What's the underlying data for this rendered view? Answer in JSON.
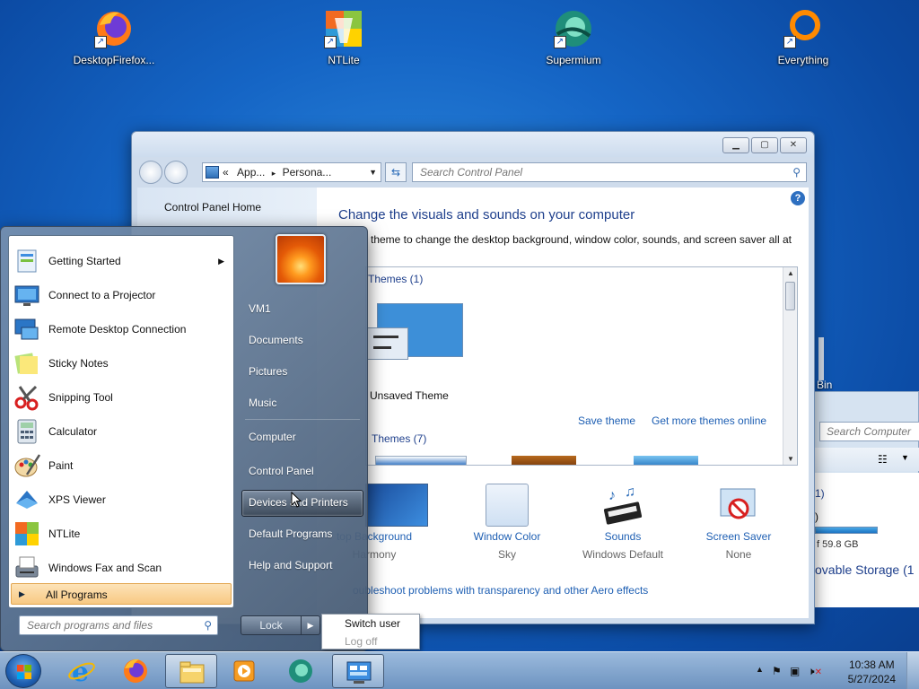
{
  "desktop": {
    "icons": [
      {
        "label": "DesktopFirefox... "
      },
      {
        "label": "NTLite"
      },
      {
        "label": "Supermium"
      },
      {
        "label": "Everything"
      }
    ],
    "recycle_bin_label": "Bin"
  },
  "control_panel": {
    "breadcrumb_prefix": "«",
    "breadcrumb_1": "App...",
    "breadcrumb_sep": "▸",
    "breadcrumb_2": "Persona...",
    "search_placeholder": "Search Control Panel",
    "window_buttons": {
      "minimize": "▁",
      "maximize": "▢",
      "close": "✕"
    },
    "left_link": "Control Panel Home",
    "heading": "Change the visuals and sounds on your computer",
    "subtext": "theme to change the desktop background, window color, sounds, and screen saver all at",
    "my_themes_label": "Themes (1)",
    "unsaved_theme": "Unsaved Theme",
    "save_theme": "Save theme",
    "get_more_themes": "Get more themes online",
    "aero_themes_label": "Themes (7)",
    "bottom_items": [
      {
        "title": "top Background",
        "value": "Harmony"
      },
      {
        "title": "Window Color",
        "value": "Sky"
      },
      {
        "title": "Sounds",
        "value": "Windows Default"
      },
      {
        "title": "Screen Saver",
        "value": "None"
      }
    ],
    "aero_link": "oubleshoot problems with transparency and other Aero effects"
  },
  "computer_window": {
    "search_placeholder": "Search Computer",
    "line1": "1)",
    "line2": ")",
    "free_text": "f 59.8 GB",
    "removable": "ovable Storage (1"
  },
  "start_menu": {
    "programs": [
      {
        "label": "Getting Started",
        "has_arrow": true
      },
      {
        "label": "Connect to a Projector"
      },
      {
        "label": "Remote Desktop Connection"
      },
      {
        "label": "Sticky Notes"
      },
      {
        "label": "Snipping Tool"
      },
      {
        "label": "Calculator"
      },
      {
        "label": "Paint"
      },
      {
        "label": "XPS Viewer"
      },
      {
        "label": "NTLite"
      },
      {
        "label": "Windows Fax and Scan"
      }
    ],
    "all_programs": "All Programs",
    "search_placeholder": "Search programs and files",
    "right_items": [
      {
        "label": "VM1"
      },
      {
        "label": "Documents"
      },
      {
        "label": "Pictures"
      },
      {
        "label": "Music"
      },
      {
        "label": "Computer"
      },
      {
        "label": "Control Panel"
      },
      {
        "label": "Devices and Printers"
      },
      {
        "label": "Default Programs"
      },
      {
        "label": "Help and Support"
      }
    ],
    "lock_button": "Lock",
    "power_menu": {
      "switch_user": "Switch user",
      "log_off": "Log off"
    }
  },
  "taskbar": {
    "clock_time": "10:38 AM",
    "clock_date": "5/27/2024",
    "show_hidden_arrow": "▲"
  },
  "colors": {
    "link_blue": "#1e5fb3",
    "heading_blue": "#1e3f8c",
    "all_programs_highlight": "#f8c983"
  }
}
